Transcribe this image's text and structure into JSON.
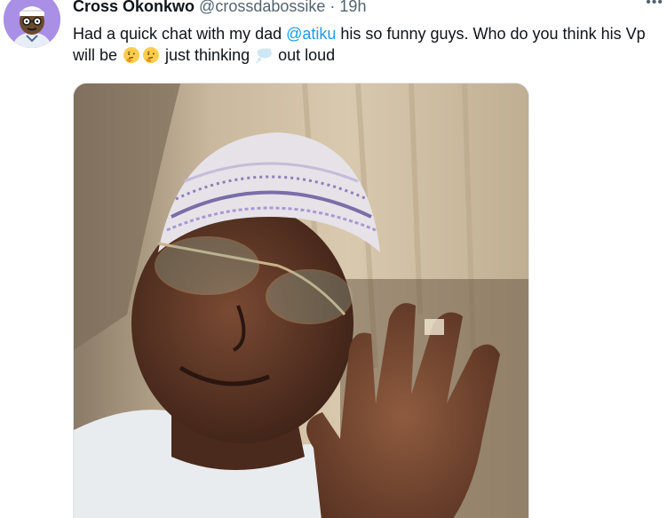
{
  "tweet": {
    "display_name": "Cross Okonkwo",
    "handle": "@crossdabossike",
    "separator": "·",
    "timestamp": "19h",
    "more_icon": "more-options-icon",
    "text": {
      "part1": "Had a quick chat with my dad ",
      "mention": "@atiku",
      "part2": " his so funny guys. Who do you think his Vp will be ",
      "emoji_1": "thinking-face-emoji",
      "emoji_2": "thinking-face-emoji",
      "part3": " just thinking ",
      "emoji_3": "thought-balloon-emoji",
      "part4": " out loud"
    },
    "media": {
      "type": "photo",
      "subject": "man-with-cap-waving-photo"
    }
  },
  "colors": {
    "link": "#1d9bf0",
    "secondary_text": "#536471",
    "primary_text": "#0f1419",
    "avatar_bg": "#a98fe6"
  }
}
